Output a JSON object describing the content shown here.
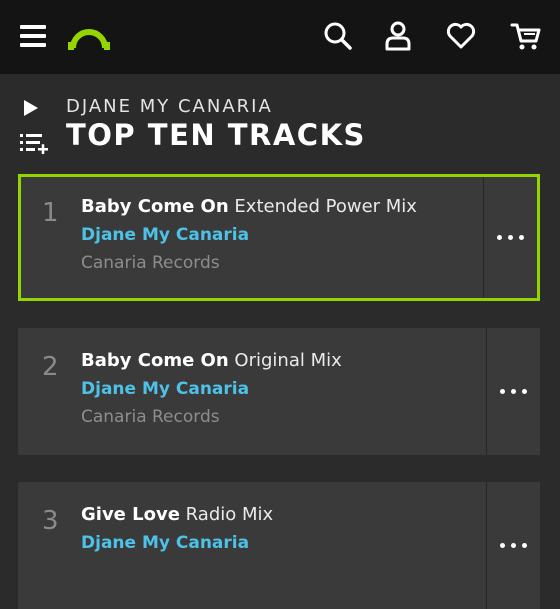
{
  "header": {
    "icons": [
      "menu-icon",
      "beatport-logo",
      "search-icon",
      "account-icon",
      "heart-icon",
      "cart-icon"
    ]
  },
  "chart": {
    "artist": "DJANE MY CANARIA",
    "title": "TOP TEN TRACKS"
  },
  "tracks": [
    {
      "number": "1",
      "title": "Baby Come On",
      "mix": "Extended Power Mix",
      "artist": "Djane My Canaria",
      "label": "Canaria Records",
      "selected": true
    },
    {
      "number": "2",
      "title": "Baby Come On",
      "mix": "Original Mix",
      "artist": "Djane My Canaria",
      "label": "Canaria Records",
      "selected": false
    },
    {
      "number": "3",
      "title": "Give Love",
      "mix": "Radio Mix",
      "artist": "Djane My Canaria",
      "label": "",
      "selected": false
    }
  ],
  "colors": {
    "accent": "#94d500",
    "artist_link": "#4ec1e6",
    "topbar": "#141414",
    "background": "#2b2b2b",
    "card": "#3a3a3a"
  }
}
